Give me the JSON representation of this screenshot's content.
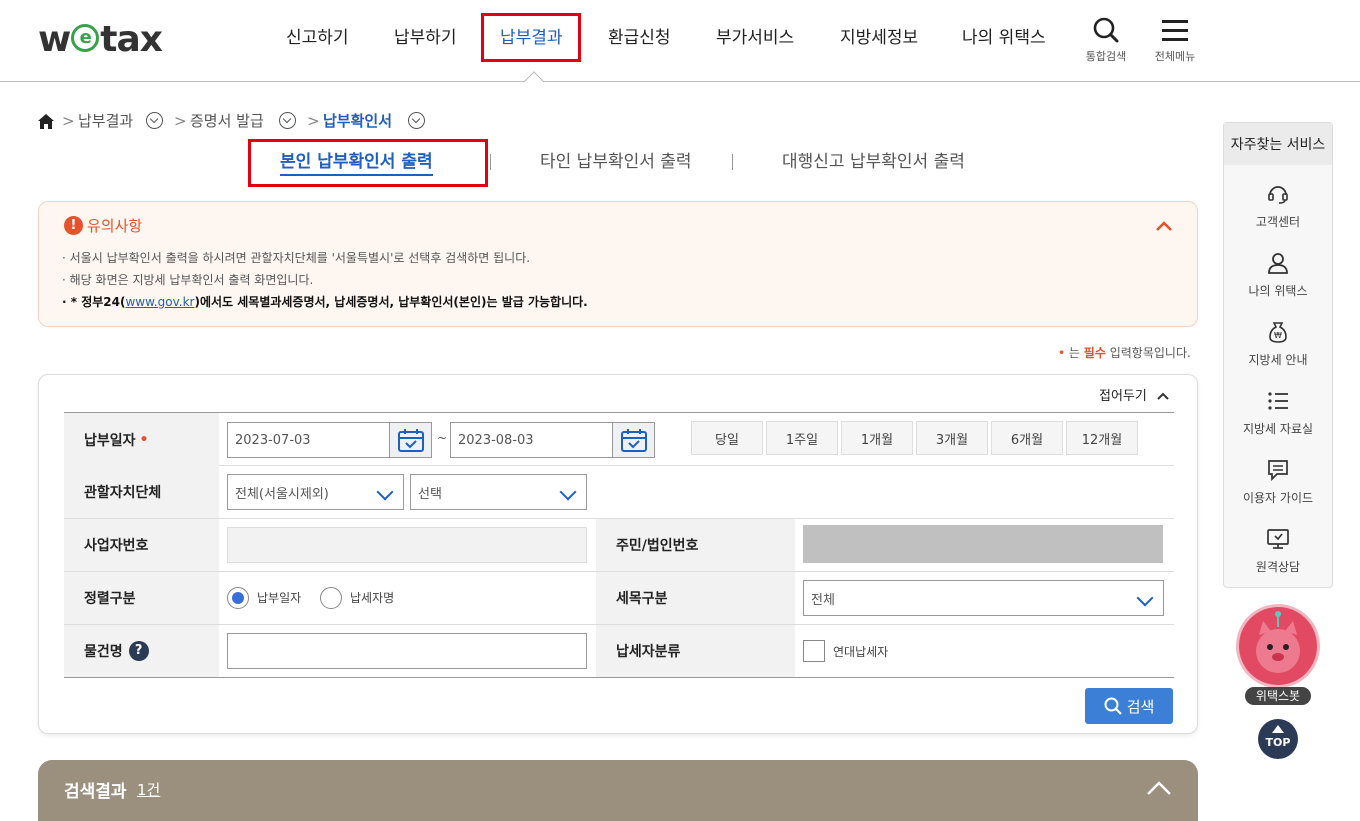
{
  "header": {
    "logo": {
      "pre": "w",
      "e": "e",
      "post": "tax"
    },
    "nav": [
      "신고하기",
      "납부하기",
      "납부결과",
      "환급신청",
      "부가서비스",
      "지방세정보",
      "나의 위택스"
    ],
    "active_nav": "납부결과",
    "search_label": "통합검색",
    "menu_label": "전체메뉴"
  },
  "breadcrumb": {
    "home_icon": "home-icon",
    "items": [
      "납부결과",
      "증명서 발급",
      "납부확인서"
    ]
  },
  "tabs": [
    "본인 납부확인서 출력",
    "타인 납부확인서 출력",
    "대행신고 납부확인서 출력"
  ],
  "notice": {
    "title": "유의사항",
    "lines": [
      "· 서울시 납부확인서 출력을 하시려면 관할자치단체를 '서울특별시'로 선택후 검색하면 됩니다.",
      "· 해당 화면은 지방세 납부확인서 출력 화면입니다."
    ],
    "bold_pre": "· * 정부24(",
    "bold_link": "www.gov.kr",
    "bold_post": ")에서도 세목별과세증명서, 납세증명서, 납부확인서(본인)는 발급 가능합니다."
  },
  "required_note": {
    "bullet": "•",
    "pre": "는",
    "strong": "필수",
    "post": "입력항목입니다."
  },
  "form": {
    "collapse_label": "접어두기",
    "pay_date_label": "납부일자",
    "date_from": "2023-07-03",
    "date_sep": "~",
    "date_to": "2023-08-03",
    "periods": [
      "당일",
      "1주일",
      "1개월",
      "3개월",
      "6개월",
      "12개월"
    ],
    "region_label": "관할자치단체",
    "region_value": "전체(서울시제외)",
    "subregion_value": "선택",
    "biz_no_label": "사업자번호",
    "resident_no_label": "주민/법인번호",
    "sort_label": "정렬구분",
    "sort_options": [
      "납부일자",
      "납세자명"
    ],
    "tax_item_label": "세목구분",
    "tax_item_value": "전체",
    "property_label": "물건명",
    "taxpayer_type_label": "납세자분류",
    "joint_label": "연대납세자",
    "search_button": "검색"
  },
  "results": {
    "title": "검색결과",
    "count": "1건"
  },
  "side": {
    "title": "자주찾는 서비스",
    "items": [
      "고객센터",
      "나의 위택스",
      "지방세 안내",
      "지방세 자료실",
      "이용자 가이드",
      "원격상담"
    ]
  },
  "bot_label": "위택스봇",
  "top_label": "TOP",
  "colors": {
    "accent": "#1f5fbf",
    "highlight": "#e30010",
    "notice": "#e8522a",
    "search_btn": "#3b7fd6",
    "results_bar": "#9b8f7e"
  }
}
